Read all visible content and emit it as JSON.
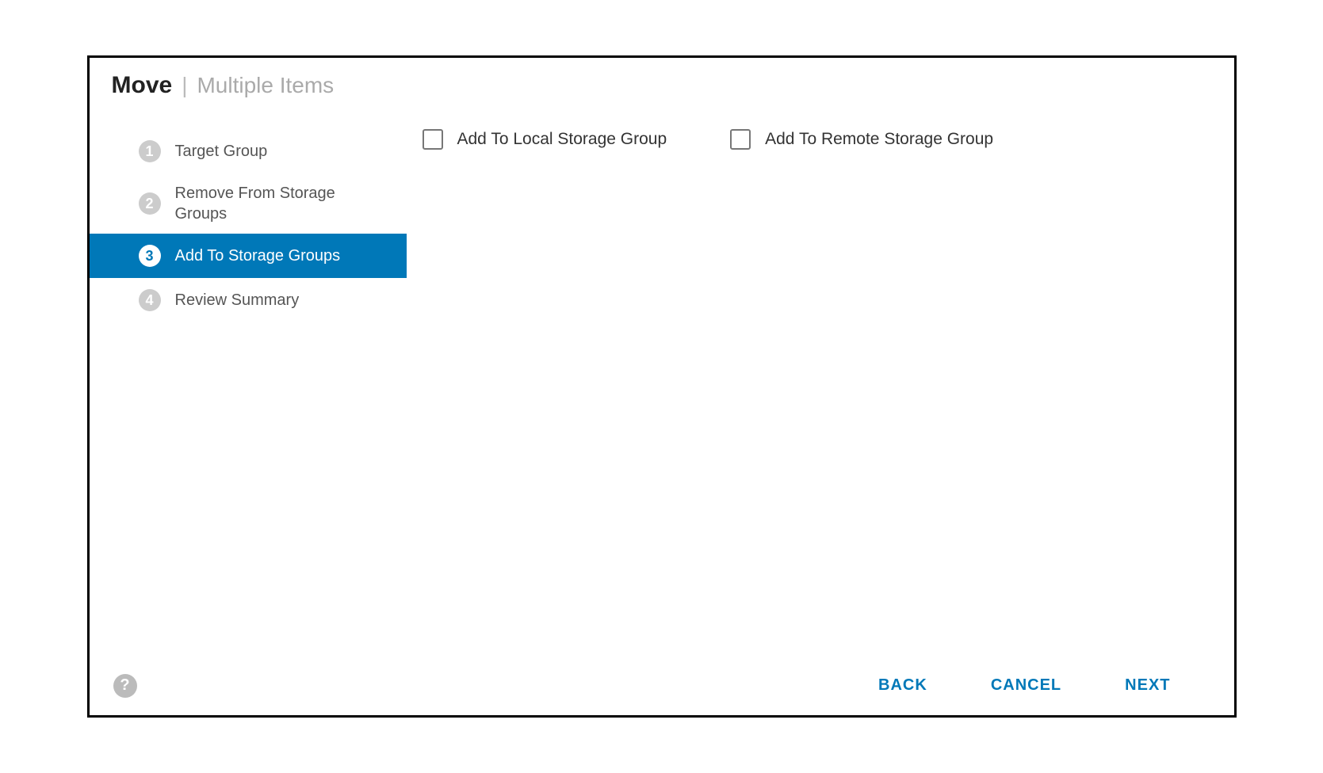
{
  "header": {
    "title": "Move",
    "separator": "|",
    "subtitle": "Multiple Items"
  },
  "steps": [
    {
      "number": "1",
      "label": "Target Group",
      "active": false
    },
    {
      "number": "2",
      "label": "Remove From Storage Groups",
      "active": false
    },
    {
      "number": "3",
      "label": "Add To Storage Groups",
      "active": true
    },
    {
      "number": "4",
      "label": "Review Summary",
      "active": false
    }
  ],
  "options": {
    "local": {
      "label": "Add To Local Storage Group",
      "checked": false
    },
    "remote": {
      "label": "Add To Remote Storage Group",
      "checked": false
    }
  },
  "footer": {
    "help": "?",
    "back": "BACK",
    "cancel": "CANCEL",
    "next": "NEXT"
  }
}
